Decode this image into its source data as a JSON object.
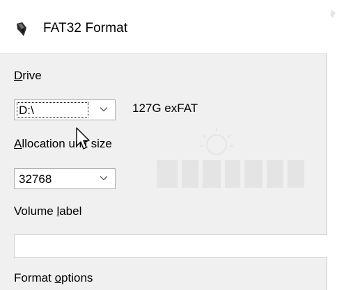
{
  "window": {
    "title": "FAT32 Format",
    "app_icon": "fat32format-app-icon"
  },
  "drive": {
    "label": "Drive",
    "mnemonic": "D",
    "rest": "rive",
    "selected": "D:\\",
    "info": "127G exFAT"
  },
  "allocation": {
    "label": "Allocation unit size",
    "mnemonic": "A",
    "rest": "llocation unit size",
    "selected": "32768"
  },
  "volume": {
    "label": "Volume label",
    "before": "Volume ",
    "mnemonic": "l",
    "after": "abel",
    "value": ""
  },
  "format_options": {
    "label": "Format options",
    "before": "Format ",
    "mnemonic": "o",
    "after": "ptions"
  },
  "icons": {
    "dropdown": "chevron-down-icon",
    "cursor": "mouse-pointer-icon"
  },
  "colors": {
    "window_bg": "#f0f0f0",
    "titlebar_bg": "#ffffff",
    "field_border": "#adadad",
    "text": "#000000"
  }
}
